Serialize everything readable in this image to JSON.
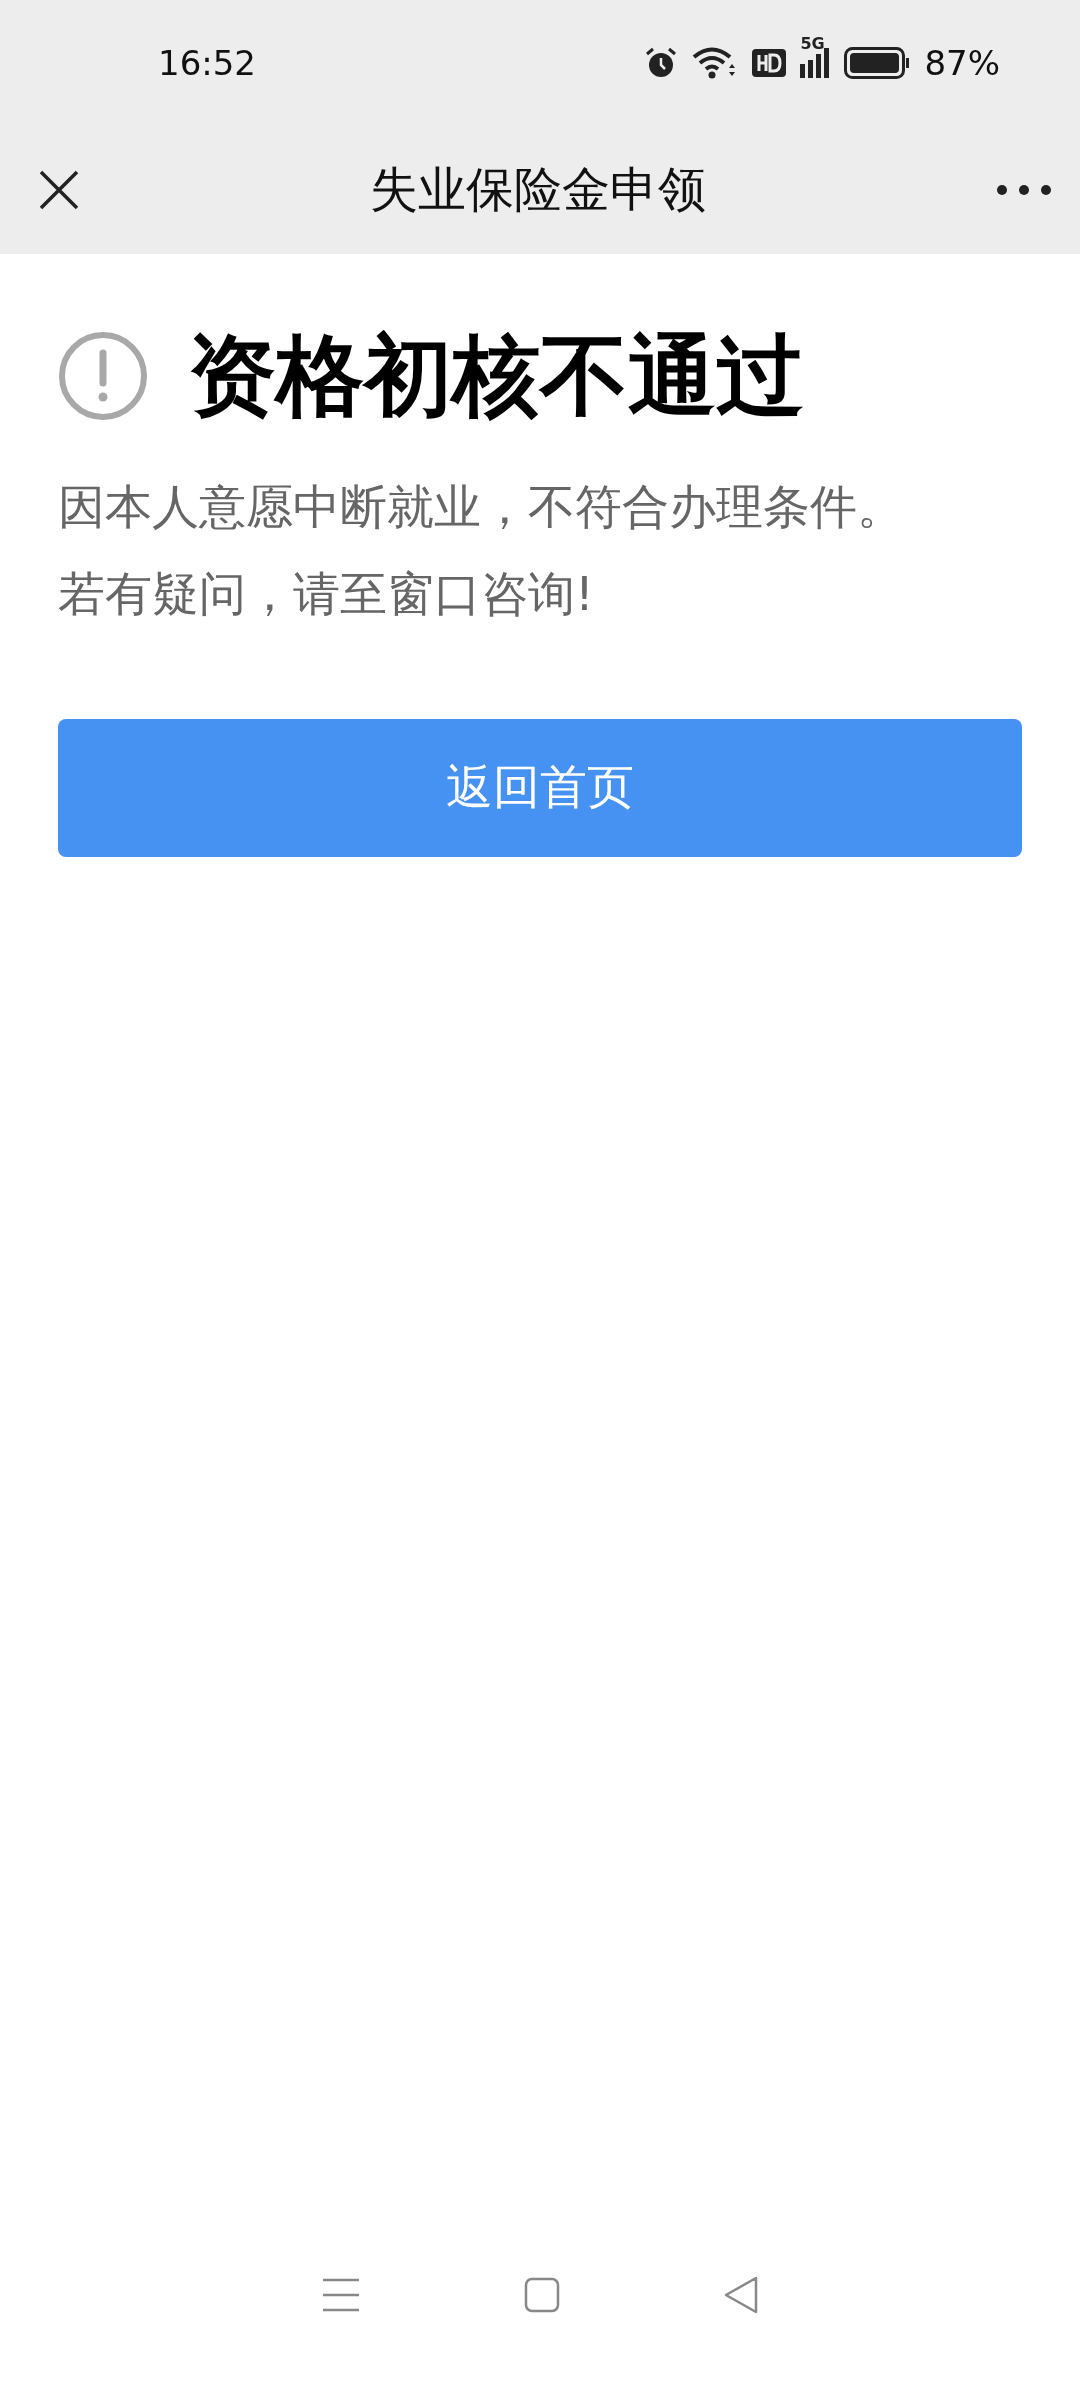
{
  "status_bar": {
    "time": "16:52",
    "network": "5G",
    "battery": "87%"
  },
  "nav_bar": {
    "title": "失业保险金申领"
  },
  "result": {
    "title": "资格初核不通过",
    "message_lines": [
      "因本人意愿中断就业，不符合办理条件。",
      "若有疑问，请至窗口咨询!"
    ]
  },
  "button": {
    "label": "返回首页"
  }
}
